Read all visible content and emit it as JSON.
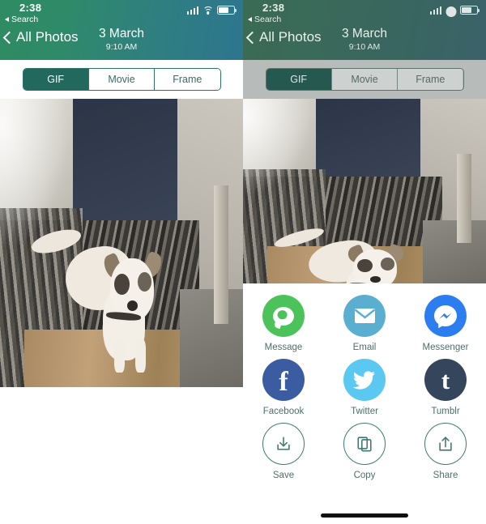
{
  "status_bar": {
    "time": "2:38",
    "back_app_label": "Search",
    "back_app_icon": "triangle-left-icon",
    "signal_icon": "cellular-signal-icon",
    "wifi_icon": "wifi-icon",
    "battery_icon": "battery-icon"
  },
  "nav_bar": {
    "back_label": "All Photos",
    "back_icon": "chevron-left-icon",
    "title": "3 March",
    "subtitle": "9:10 AM"
  },
  "tabs": [
    {
      "label": "GIF",
      "selected": true
    },
    {
      "label": "Movie",
      "selected": false
    },
    {
      "label": "Frame",
      "selected": false
    }
  ],
  "photo": {
    "alt": "white and tan dog standing on striped stair carpet runner"
  },
  "share_sheet": {
    "rows": [
      [
        {
          "label": "Message",
          "icon": "message-bubble-icon",
          "color": "#4CC35A"
        },
        {
          "label": "Email",
          "icon": "envelope-icon",
          "color": "#5AAED0"
        },
        {
          "label": "Messenger",
          "icon": "messenger-bolt-icon",
          "color": "#2C7EF0"
        }
      ],
      [
        {
          "label": "Facebook",
          "icon": "facebook-f-icon",
          "color": "#3B5CA0"
        },
        {
          "label": "Twitter",
          "icon": "twitter-bird-icon",
          "color": "#5AC8F0"
        },
        {
          "label": "Tumblr",
          "icon": "tumblr-t-icon",
          "color": "#35465C"
        }
      ],
      [
        {
          "label": "Save",
          "icon": "download-icon",
          "color": "#3D7A70"
        },
        {
          "label": "Copy",
          "icon": "copy-duplicate-icon",
          "color": "#3D7A70"
        },
        {
          "label": "Share",
          "icon": "share-upload-icon",
          "color": "#3D7A70"
        }
      ]
    ]
  },
  "home_indicator": {
    "icon": "home-indicator-bar"
  },
  "theme": {
    "header_start": "#2E8B62",
    "header_end": "#2D7590",
    "accent_teal": "#22685C",
    "label_teal": "#4E6F69",
    "dim_overlay": "#B7BCBA"
  }
}
